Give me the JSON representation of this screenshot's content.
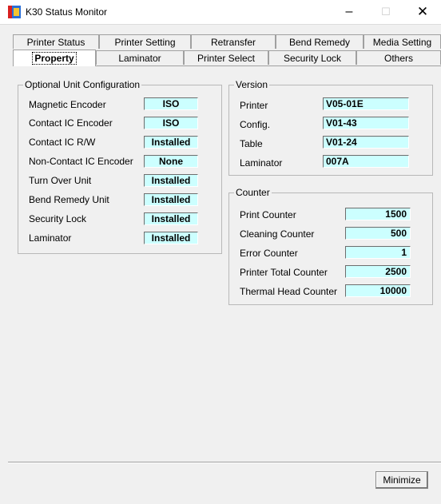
{
  "window": {
    "title": "K30 Status Monitor",
    "minimize_glyph": "–",
    "maximize_glyph": "☐",
    "close_glyph": "✕"
  },
  "tabs": {
    "row1": [
      "Printer Status",
      "Printer Setting",
      "Retransfer",
      "Bend Remedy",
      "Media Setting"
    ],
    "row2": [
      "Property",
      "Laminator",
      "Printer Select",
      "Security Lock",
      "Others"
    ],
    "selected": "Property"
  },
  "optional_unit": {
    "title": "Optional Unit Configuration",
    "rows": [
      {
        "label": "Magnetic Encoder",
        "value": "ISO"
      },
      {
        "label": "Contact IC Encoder",
        "value": "ISO"
      },
      {
        "label": "Contact IC R/W",
        "value": "Installed"
      },
      {
        "label": "Non-Contact IC Encoder",
        "value": "None"
      },
      {
        "label": "Turn Over Unit",
        "value": "Installed"
      },
      {
        "label": "Bend Remedy Unit",
        "value": "Installed"
      },
      {
        "label": "Security Lock",
        "value": "Installed"
      },
      {
        "label": "Laminator",
        "value": "Installed"
      }
    ]
  },
  "version": {
    "title": "Version",
    "rows": [
      {
        "label": "Printer",
        "value": "V05-01E"
      },
      {
        "label": "Config.",
        "value": "V01-43"
      },
      {
        "label": "Table",
        "value": "V01-24"
      },
      {
        "label": "Laminator",
        "value": "007A"
      }
    ]
  },
  "counter": {
    "title": "Counter",
    "rows": [
      {
        "label": "Print Counter",
        "value": "1500"
      },
      {
        "label": "Cleaning Counter",
        "value": "500"
      },
      {
        "label": "Error Counter",
        "value": "1"
      },
      {
        "label": "Printer Total Counter",
        "value": "2500"
      },
      {
        "label": "Thermal Head Counter",
        "value": "10000"
      }
    ]
  },
  "footer": {
    "minimize_label": "Minimize"
  },
  "colors": {
    "value_bg": "#ccffff",
    "dialog_bg": "#f0f0f0"
  }
}
